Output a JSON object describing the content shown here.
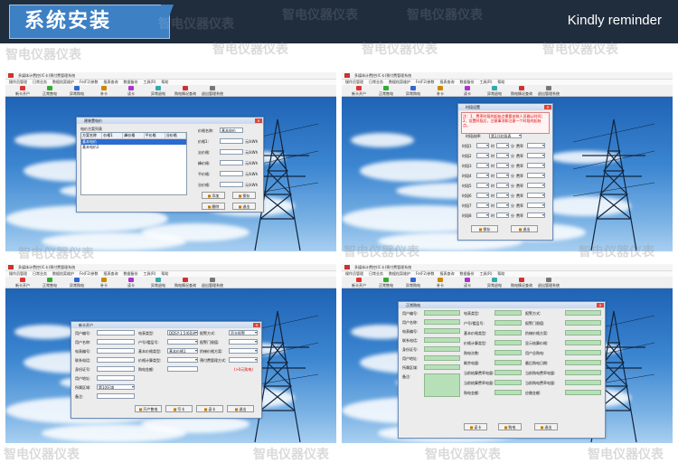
{
  "header": {
    "title": "系统安装",
    "reminder": "Kindly reminder",
    "watermark": "智电仪器仪表"
  },
  "app": {
    "title": "多媒体计费控(IC卡)预付费管理系统",
    "menu": [
      "操作员管理",
      "日常业务",
      "数据档案维护",
      "Fe(F2)参数",
      "报表查询",
      "数据备份",
      "工具(R)",
      "帮助"
    ],
    "toolbar": [
      "新卡开户",
      "正常售电",
      "异常购电",
      "补卡",
      "读卡",
      "异常卡",
      "误作卡",
      "清零卡",
      "异常退电",
      "购电情况查询",
      "退出管理系统"
    ]
  },
  "panel1": {
    "dialog_title": "建装置电价",
    "list_title": "电价方案列表",
    "list_headers": [
      "方案名称",
      "价格1",
      "峰价格",
      "平价格",
      "谷价格"
    ],
    "list_rows": [
      "基本电价",
      "基本电价2"
    ],
    "labels": [
      "价格名称:",
      "价格1:",
      "尖价格:",
      "峰价格:",
      "平价格:",
      "谷价格:"
    ],
    "name_value": "基本电价",
    "unit": "元/kWh",
    "buttons": [
      "添加",
      "保存",
      "删除",
      "退出"
    ]
  },
  "panel2": {
    "dialog_title": "时段设置",
    "notice": "注：1、费率时段的起始点需要安装人员确认时间；2、设置时段后，注意事项和注意一个时段的起始点。",
    "scheme_label": "时段选择:",
    "scheme_value": "第1日时段表",
    "rows": [
      "时段1",
      "时段2",
      "时段3",
      "时段4",
      "时段5",
      "时段6",
      "时段7",
      "时段8"
    ],
    "col_labels": [
      "时",
      "分",
      "费率"
    ],
    "buttons": [
      "保存",
      "退出"
    ]
  },
  "panel3": {
    "dialog_title": "新卡开户",
    "labels_left": [
      "用户编号:",
      "用户名称:",
      "电表编号:",
      "联系电话:",
      "身份证号:",
      "用户地址:",
      "所属区域:",
      "备注:"
    ],
    "labels_mid": [
      "电表类型:",
      "户号/楼层号:",
      "基本价格类型:",
      "价格计算类型:",
      "购电金额:"
    ],
    "labels_right": [
      "报警方式:",
      "报警门限值:",
      "阶梯价格方案:",
      "预付费管理方式:",
      "在买电量金额:"
    ],
    "meter_type": "DDSY-1.5(60)A",
    "price_value": "基本价格1",
    "area_value": "第10区域",
    "warn_mode": "声光报警",
    "amount_note": "(>0元购电)",
    "buttons": [
      "开户售电",
      "写卡",
      "读卡",
      "退出"
    ]
  },
  "panel4": {
    "dialog_title": "正常购电",
    "labels_left": [
      "用户编号:",
      "用户名称:",
      "电表编号:",
      "联系电话:",
      "身份证号:",
      "用户地址:",
      "所属区域:",
      "备注:"
    ],
    "labels_mid": [
      "电表类型:",
      "户号/楼层号:",
      "基本价格类型:",
      "价格计算类型:",
      "购电次数:",
      "剩余电量:",
      "当前结算费率电量:",
      "当前结算费率电量:",
      "购电金额:"
    ],
    "labels_right": [
      "报警方式:",
      "报警门限值:",
      "阶梯价格方案:",
      "显示结算价格:",
      "用户总购电:",
      "最后购电日期:",
      "当前购电费率电量:",
      "当前购电费率电量:",
      "应缴金额:"
    ],
    "buttons": [
      "读卡",
      "购电",
      "退出"
    ]
  }
}
